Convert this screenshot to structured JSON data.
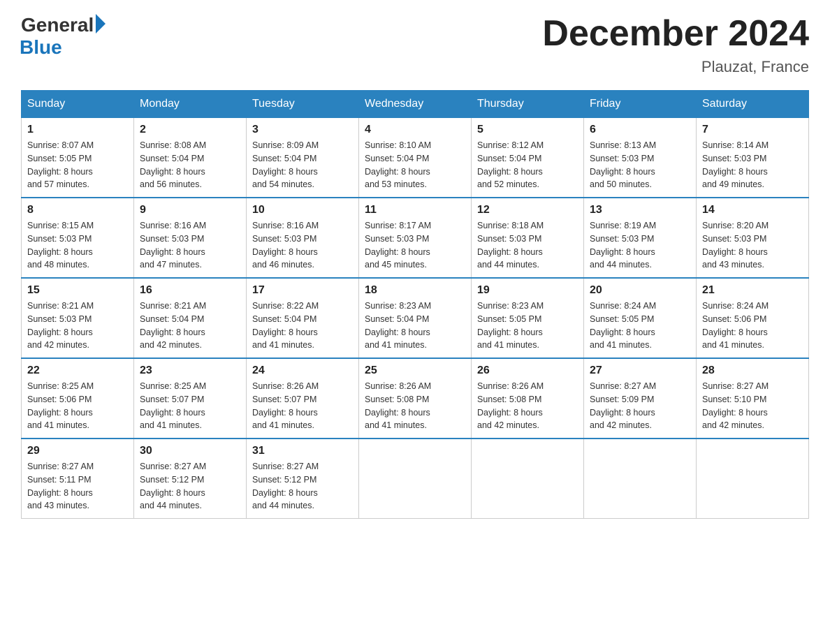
{
  "header": {
    "logo_general": "General",
    "logo_blue": "Blue",
    "title": "December 2024",
    "subtitle": "Plauzat, France"
  },
  "weekdays": [
    "Sunday",
    "Monday",
    "Tuesday",
    "Wednesday",
    "Thursday",
    "Friday",
    "Saturday"
  ],
  "weeks": [
    [
      {
        "day": "1",
        "sunrise": "8:07 AM",
        "sunset": "5:05 PM",
        "daylight": "8 hours and 57 minutes."
      },
      {
        "day": "2",
        "sunrise": "8:08 AM",
        "sunset": "5:04 PM",
        "daylight": "8 hours and 56 minutes."
      },
      {
        "day": "3",
        "sunrise": "8:09 AM",
        "sunset": "5:04 PM",
        "daylight": "8 hours and 54 minutes."
      },
      {
        "day": "4",
        "sunrise": "8:10 AM",
        "sunset": "5:04 PM",
        "daylight": "8 hours and 53 minutes."
      },
      {
        "day": "5",
        "sunrise": "8:12 AM",
        "sunset": "5:04 PM",
        "daylight": "8 hours and 52 minutes."
      },
      {
        "day": "6",
        "sunrise": "8:13 AM",
        "sunset": "5:03 PM",
        "daylight": "8 hours and 50 minutes."
      },
      {
        "day": "7",
        "sunrise": "8:14 AM",
        "sunset": "5:03 PM",
        "daylight": "8 hours and 49 minutes."
      }
    ],
    [
      {
        "day": "8",
        "sunrise": "8:15 AM",
        "sunset": "5:03 PM",
        "daylight": "8 hours and 48 minutes."
      },
      {
        "day": "9",
        "sunrise": "8:16 AM",
        "sunset": "5:03 PM",
        "daylight": "8 hours and 47 minutes."
      },
      {
        "day": "10",
        "sunrise": "8:16 AM",
        "sunset": "5:03 PM",
        "daylight": "8 hours and 46 minutes."
      },
      {
        "day": "11",
        "sunrise": "8:17 AM",
        "sunset": "5:03 PM",
        "daylight": "8 hours and 45 minutes."
      },
      {
        "day": "12",
        "sunrise": "8:18 AM",
        "sunset": "5:03 PM",
        "daylight": "8 hours and 44 minutes."
      },
      {
        "day": "13",
        "sunrise": "8:19 AM",
        "sunset": "5:03 PM",
        "daylight": "8 hours and 44 minutes."
      },
      {
        "day": "14",
        "sunrise": "8:20 AM",
        "sunset": "5:03 PM",
        "daylight": "8 hours and 43 minutes."
      }
    ],
    [
      {
        "day": "15",
        "sunrise": "8:21 AM",
        "sunset": "5:03 PM",
        "daylight": "8 hours and 42 minutes."
      },
      {
        "day": "16",
        "sunrise": "8:21 AM",
        "sunset": "5:04 PM",
        "daylight": "8 hours and 42 minutes."
      },
      {
        "day": "17",
        "sunrise": "8:22 AM",
        "sunset": "5:04 PM",
        "daylight": "8 hours and 41 minutes."
      },
      {
        "day": "18",
        "sunrise": "8:23 AM",
        "sunset": "5:04 PM",
        "daylight": "8 hours and 41 minutes."
      },
      {
        "day": "19",
        "sunrise": "8:23 AM",
        "sunset": "5:05 PM",
        "daylight": "8 hours and 41 minutes."
      },
      {
        "day": "20",
        "sunrise": "8:24 AM",
        "sunset": "5:05 PM",
        "daylight": "8 hours and 41 minutes."
      },
      {
        "day": "21",
        "sunrise": "8:24 AM",
        "sunset": "5:06 PM",
        "daylight": "8 hours and 41 minutes."
      }
    ],
    [
      {
        "day": "22",
        "sunrise": "8:25 AM",
        "sunset": "5:06 PM",
        "daylight": "8 hours and 41 minutes."
      },
      {
        "day": "23",
        "sunrise": "8:25 AM",
        "sunset": "5:07 PM",
        "daylight": "8 hours and 41 minutes."
      },
      {
        "day": "24",
        "sunrise": "8:26 AM",
        "sunset": "5:07 PM",
        "daylight": "8 hours and 41 minutes."
      },
      {
        "day": "25",
        "sunrise": "8:26 AM",
        "sunset": "5:08 PM",
        "daylight": "8 hours and 41 minutes."
      },
      {
        "day": "26",
        "sunrise": "8:26 AM",
        "sunset": "5:08 PM",
        "daylight": "8 hours and 42 minutes."
      },
      {
        "day": "27",
        "sunrise": "8:27 AM",
        "sunset": "5:09 PM",
        "daylight": "8 hours and 42 minutes."
      },
      {
        "day": "28",
        "sunrise": "8:27 AM",
        "sunset": "5:10 PM",
        "daylight": "8 hours and 42 minutes."
      }
    ],
    [
      {
        "day": "29",
        "sunrise": "8:27 AM",
        "sunset": "5:11 PM",
        "daylight": "8 hours and 43 minutes."
      },
      {
        "day": "30",
        "sunrise": "8:27 AM",
        "sunset": "5:12 PM",
        "daylight": "8 hours and 44 minutes."
      },
      {
        "day": "31",
        "sunrise": "8:27 AM",
        "sunset": "5:12 PM",
        "daylight": "8 hours and 44 minutes."
      },
      null,
      null,
      null,
      null
    ]
  ],
  "labels": {
    "sunrise": "Sunrise:",
    "sunset": "Sunset:",
    "daylight": "Daylight:"
  }
}
